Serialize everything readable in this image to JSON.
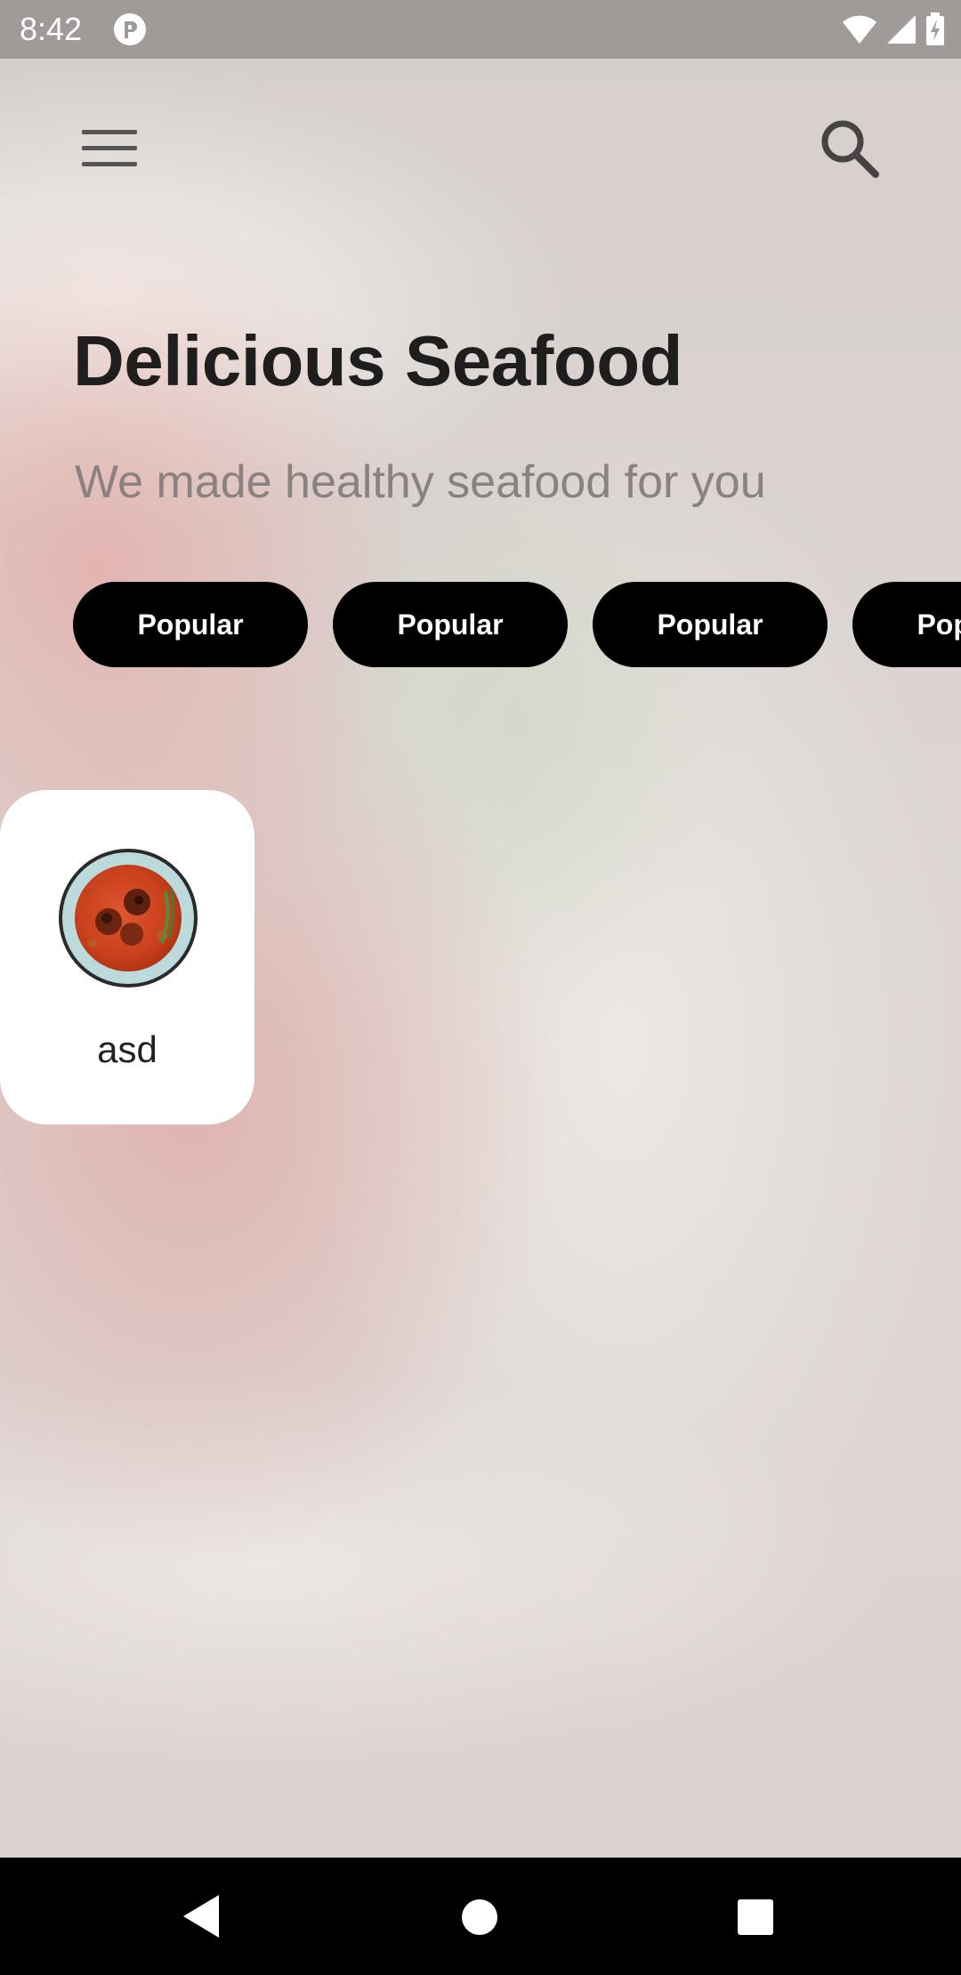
{
  "status_bar": {
    "time": "8:42",
    "icons": [
      "app-notification-icon",
      "wifi-icon",
      "cellular-signal-icon",
      "battery-charging-icon"
    ]
  },
  "app_bar": {
    "menu_icon": "hamburger-menu-icon",
    "search_icon": "search-icon"
  },
  "header": {
    "title": "Delicious Seafood",
    "subtitle": "We made healthy seafood for you"
  },
  "chips": [
    {
      "label": "Popular"
    },
    {
      "label": "Popular"
    },
    {
      "label": "Popular"
    },
    {
      "label": "Popular"
    }
  ],
  "cards": [
    {
      "name": "asd",
      "image": "seafood-dish-plate"
    }
  ],
  "nav_bar": {
    "icons": [
      "back-icon",
      "home-icon",
      "recents-icon"
    ]
  },
  "colors": {
    "chip_background": "#000000",
    "chip_text": "#ffffff",
    "title": "#1e1e1e",
    "subtitle": "#8a8280",
    "card_background": "#ffffff",
    "status_bar": "#a09b98"
  }
}
